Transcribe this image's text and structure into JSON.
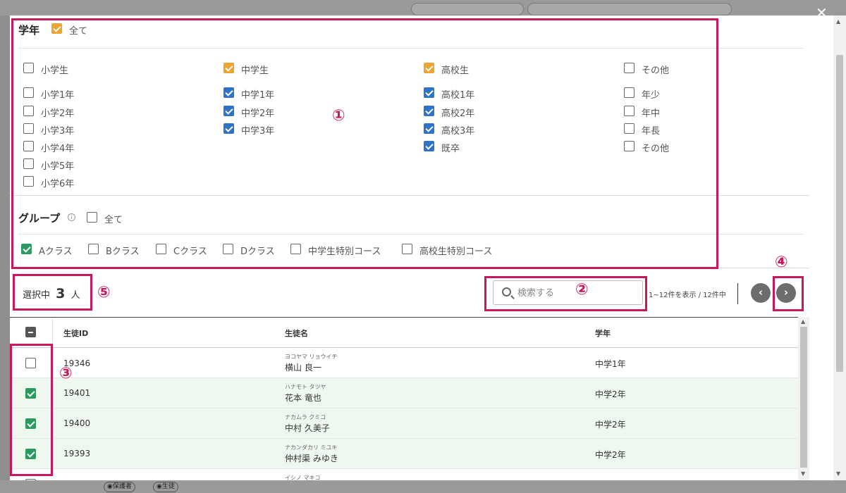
{
  "grade": {
    "title": "学年",
    "all_label": "全て",
    "columns": [
      {
        "header": "小学生",
        "items": [
          "小学1年",
          "小学2年",
          "小学3年",
          "小学4年",
          "小学5年",
          "小学6年"
        ]
      },
      {
        "header": "中学生",
        "items": [
          "中学1年",
          "中学2年",
          "中学3年"
        ]
      },
      {
        "header": "高校生",
        "items": [
          "高校1年",
          "高校2年",
          "高校3年",
          "既卒"
        ]
      },
      {
        "header": "その他",
        "items": [
          "年少",
          "年中",
          "年長",
          "その他"
        ]
      }
    ]
  },
  "group": {
    "title": "グループ",
    "all_label": "全て",
    "items": [
      "Aクラス",
      "Bクラス",
      "Cクラス",
      "Dクラス",
      "中学生特別コース",
      "高校生特別コース"
    ]
  },
  "selection": {
    "prefix": "選択中",
    "count": "3",
    "suffix": "人"
  },
  "search": {
    "placeholder": "検索する"
  },
  "pager": {
    "text": "1~12件を表示 / 12件中",
    "prev": "‹",
    "next": "›"
  },
  "table": {
    "headers": [
      "生徒ID",
      "生徒名",
      "学年"
    ],
    "rows": [
      {
        "id": "19346",
        "kana": "ヨコヤマ リョウイチ",
        "name": "横山 良一",
        "grade": "中学1年"
      },
      {
        "id": "19401",
        "kana": "ハナモト タツヤ",
        "name": "花本 竜也",
        "grade": "中学2年"
      },
      {
        "id": "19400",
        "kana": "ナカムラ クミコ",
        "name": "中村 久美子",
        "grade": "中学2年"
      },
      {
        "id": "19393",
        "kana": "ナカンダカリ ミユキ",
        "name": "仲村渠 みゆき",
        "grade": "中学2年"
      },
      {
        "id": "",
        "kana": "イシノ マキコ",
        "name": "",
        "grade": ""
      }
    ]
  },
  "annotations": [
    "①",
    "②",
    "③",
    "④",
    "⑤"
  ],
  "background": {
    "chip_guardian": "保護者",
    "chip_student": "生徒"
  },
  "colors": {
    "accent": "#c8185d",
    "orange": "#f0a32f",
    "blue": "#2f73c9",
    "green": "#2b9a5e",
    "selected_row": "#eef8ee"
  }
}
